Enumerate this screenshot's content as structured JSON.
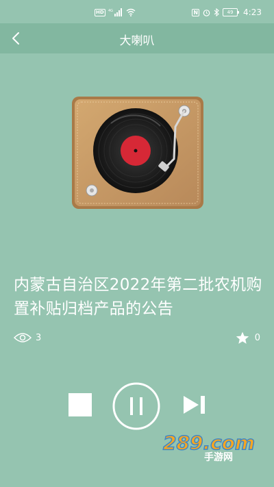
{
  "status_bar": {
    "network_badge": "HD",
    "signal_label": "4G",
    "nfc_badge": "N",
    "battery_level": "49",
    "time": "4:23"
  },
  "nav": {
    "title": "大喇叭"
  },
  "article": {
    "title": "内蒙古自治区2022年第二批农机购置补贴归档产品的公告",
    "views": "3",
    "likes": "0"
  },
  "player": {
    "state": "playing"
  },
  "watermark": {
    "main": "289.com",
    "sub": "手游网"
  },
  "colors": {
    "background": "#95c4b0",
    "nav_background": "#82b7a0",
    "foreground": "#ffffff",
    "record_label": "#d62836",
    "wood": "#c79a63"
  },
  "icons": {
    "back": "chevron-left-icon",
    "views": "eye-icon",
    "likes": "star-icon",
    "stop": "stop-icon",
    "pause": "pause-icon",
    "next": "skip-next-icon"
  }
}
